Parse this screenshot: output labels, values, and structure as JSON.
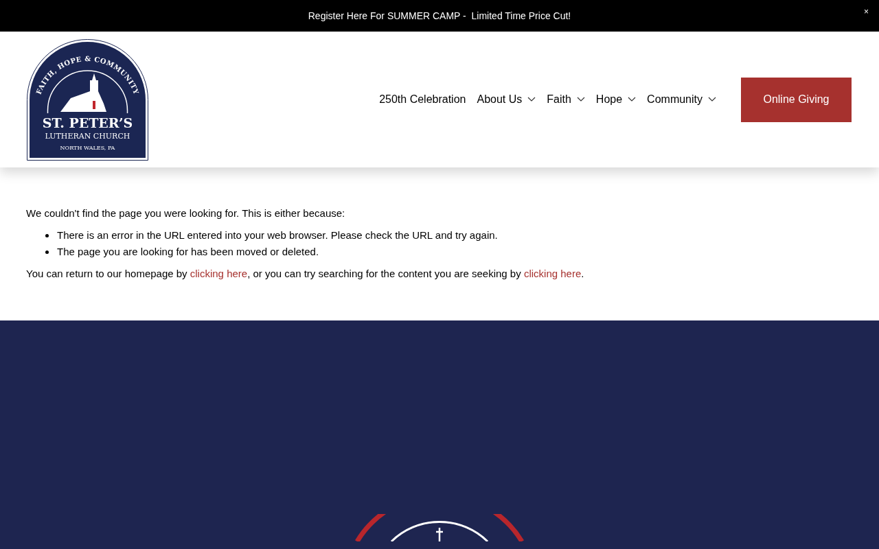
{
  "announcement": {
    "text": "Register Here For SUMMER CAMP -  Limited Time Price Cut!",
    "close": "×"
  },
  "logo": {
    "motto": "FAITH, HOPE & COMMUNITY",
    "name": "ST. PETER’S",
    "subtitle": "LUTHERAN CHURCH",
    "place": "NORTH WALES, PA"
  },
  "nav": [
    {
      "label": "250th Celebration",
      "dropdown": false
    },
    {
      "label": "About Us",
      "dropdown": true
    },
    {
      "label": "Faith",
      "dropdown": true
    },
    {
      "label": "Hope",
      "dropdown": true
    },
    {
      "label": "Community",
      "dropdown": true
    }
  ],
  "cta": "Online Giving",
  "content": {
    "intro": "We couldn't find the page you were looking for. This is either because:",
    "reasons": [
      "There is an error in the URL entered into your web browser. Please check the URL and try again.",
      "The page you are looking for has been moved or deleted."
    ],
    "outro": [
      {
        "kind": "text",
        "text": "You can return to our homepage by "
      },
      {
        "kind": "link",
        "text": "clicking here"
      },
      {
        "kind": "text",
        "text": ", or you can try searching for the content you are seeking by "
      },
      {
        "kind": "link",
        "text": "clicking here"
      },
      {
        "kind": "text",
        "text": "."
      }
    ]
  }
}
